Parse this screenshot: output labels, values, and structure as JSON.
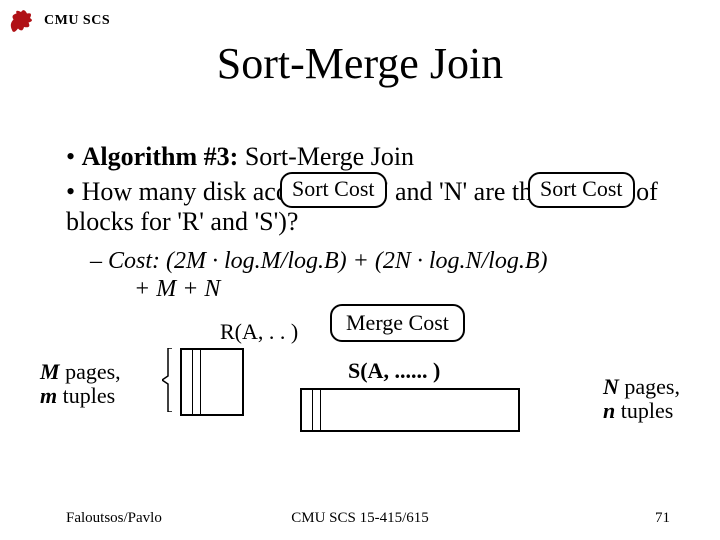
{
  "header": {
    "org": "CMU SCS"
  },
  "title": "Sort-Merge Join",
  "bullets": {
    "b1_bold": "Algorithm #3:",
    "b1_rest": " Sort-Merge Join",
    "b2": "How many disk accesses ('M' and 'N' are the number of blocks for 'R' and 'S')?"
  },
  "sub": {
    "line1": "Cost: (2M · log.M/log.B) + (2N · log.N/log.B)",
    "line2": "       + M + N"
  },
  "tags": {
    "sort": "Sort Cost",
    "merge": "Merge Cost"
  },
  "relations": {
    "R": "R(A, . . )",
    "S": "S(A, ...... )",
    "M_line1": "M ",
    "M_line1b": "pages,",
    "M_line2": "m ",
    "M_line2b": "tuples",
    "N_line1": "N ",
    "N_line1b": "pages,",
    "N_line2": "n ",
    "N_line2b": "tuples"
  },
  "footer": {
    "left": "Faloutsos/Pavlo",
    "center": "CMU SCS 15-415/615",
    "right": "71"
  }
}
